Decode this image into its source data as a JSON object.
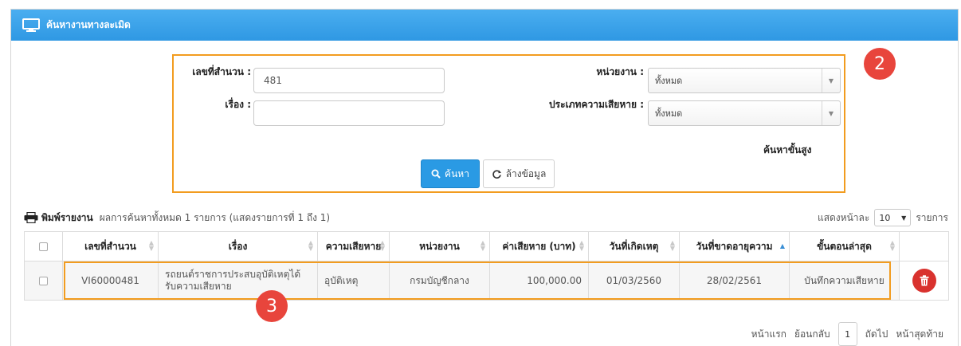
{
  "header": {
    "title": "ค้นหางานทางละเมิด",
    "icon": "monitor-icon"
  },
  "search": {
    "case_no_label": "เลขที่สำนวน :",
    "case_no_value": "481",
    "subject_label": "เรื่อง :",
    "subject_value": "",
    "agency_label": "หน่วยงาน :",
    "agency_selected": "ทั้งหมด",
    "damage_type_label": "ประเภทความเสียหาย :",
    "damage_type_selected": "ทั้งหมด",
    "advanced_link": "ค้นหาขั้นสูง",
    "search_button": "ค้นหา",
    "clear_button": "ล้างข้อมูล"
  },
  "callouts": {
    "search_area": "2",
    "result_row": "3",
    "color": "#e8453c",
    "outline_color": "#f29c1f"
  },
  "toolbar": {
    "print_label": "พิมพ์รายงาน",
    "summary": "ผลการค้นหาทั้งหมด 1 รายการ (แสดงรายการที่ 1 ถึง 1)",
    "per_page_label": "แสดงหน้าละ",
    "per_page_value": "10",
    "per_page_unit": "รายการ"
  },
  "table": {
    "columns": [
      "เลขที่สำนวน",
      "เรื่อง",
      "ความเสียหาย",
      "หน่วยงาน",
      "ค่าเสียหาย (บาท)",
      "วันที่เกิดเหตุ",
      "วันที่ขาดอายุความ",
      "ขั้นตอนล่าสุด"
    ],
    "rows": [
      {
        "case_no": "VI60000481",
        "subject": "รถยนต์ราชการประสบอุบัติเหตุได้รับความเสียหาย",
        "damage": "อุบัติเหตุ",
        "agency": "กรมบัญชีกลาง",
        "amount": "100,000.00",
        "incident_date": "01/03/2560",
        "expiry_date": "28/02/2561",
        "latest_step": "บันทึกความเสียหาย"
      }
    ]
  },
  "pager": {
    "first": "หน้าแรก",
    "prev": "ย้อนกลับ",
    "current": "1",
    "next": "ถัดไป",
    "last": "หน้าสุดท้าย"
  },
  "colors": {
    "header_blue": "#3aa3ea",
    "primary_button": "#2a9ae4",
    "delete_button": "#d9322e"
  }
}
